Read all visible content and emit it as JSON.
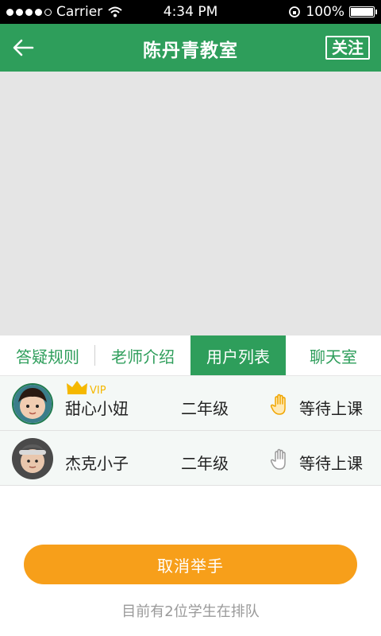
{
  "status_bar": {
    "carrier": "Carrier",
    "time": "4:34 PM",
    "battery": "100%"
  },
  "nav": {
    "title": "陈丹青教室",
    "follow_label": "关注"
  },
  "tabs": [
    {
      "label": "答疑规则"
    },
    {
      "label": "老师介绍"
    },
    {
      "label": "用户列表"
    },
    {
      "label": "聊天室"
    }
  ],
  "users": [
    {
      "name": "甜心小妞",
      "grade": "二年级",
      "status": "等待上课",
      "vip_label": "VIP",
      "hand_raised": true
    },
    {
      "name": "杰克小子",
      "grade": "二年级",
      "status": "等待上课",
      "hand_raised": false
    }
  ],
  "action": {
    "cancel_label": "取消举手"
  },
  "queue_text": "目前有2位学生在排队",
  "colors": {
    "primary_green": "#2e9e5b",
    "accent_orange": "#f79f1a",
    "vip_gold": "#f5b800"
  }
}
